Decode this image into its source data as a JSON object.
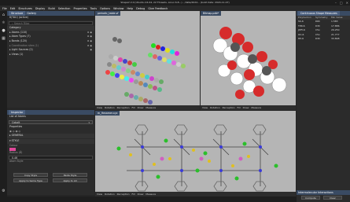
{
  "window": {
    "title": "ShapeV 2.0 (Ubuntu 24.04, 22 Threads, Linux 6.8...) - /data/2024... (build date: 2024-11-07)",
    "controls": [
      "–",
      "□",
      "✕"
    ]
  },
  "menu": [
    "File",
    "Edit",
    "Structures",
    "Display",
    "Build",
    "Selection",
    "Properties",
    "Tools",
    "Options",
    "Window",
    "Help",
    "Debug",
    "Give Feedback"
  ],
  "left_icons": [
    "house-icon",
    "molecule-icon",
    "atom-icon",
    "grid-icon",
    "wrench-icon"
  ],
  "structure_panel": {
    "tabs": [
      "Structure",
      "Gallery"
    ],
    "subtitle": "6(TAU) (active)",
    "search_placeholder": "Search Filter",
    "category_label": "Category",
    "items": [
      {
        "label": "▸ Atoms (110)"
      },
      {
        "label": "▸ Atom Types (7)"
      },
      {
        "label": "▸ Bonds (120)"
      },
      {
        "label": "▸ Coordination sites (1)"
      },
      {
        "label": "▸ Light Sources (2)"
      },
      {
        "label": "▸ Views (1)"
      }
    ]
  },
  "inspector": {
    "title": "Inspector",
    "subtitle": "List of Atoms",
    "element": "Cobalt",
    "section_properties": "Properties",
    "section_general": "GENERAL",
    "section_style": "STYLE",
    "style_labels": {
      "color": "Colour",
      "radius": "Radius (Å)",
      "radius_value": "0.46",
      "atom_style": "Atom Style"
    },
    "buttons": {
      "copy": "Copy Style",
      "paste": "Paste Style",
      "apply_type": "Apply to Same Type",
      "apply_all": "Apply to All"
    }
  },
  "viewports": {
    "v1_tab": "periodic_table.vf",
    "v2_tab": "Bitmap.pdb*",
    "v3_tab": "m_Hexamer.xyz",
    "toolbar": [
      "View",
      "Rotation",
      "Perception",
      "Fill",
      "Draw",
      "Measure"
    ]
  },
  "csm": {
    "title": "Continuous Shape Measures",
    "columns": [
      "Polyhedron",
      "Symmetry",
      "Min Value"
    ],
    "rows": [
      {
        "name": "SS-6",
        "sym": "D6h",
        "val": "1.583"
      },
      {
        "name": "TPR-6",
        "sym": "D3h",
        "val": "17.886"
      },
      {
        "name": "JPPY-6",
        "sym": "C5v",
        "val": "29.250"
      },
      {
        "name": "OC-6",
        "sym": "C5v",
        "val": "21.777"
      },
      {
        "name": "HP-6",
        "sym": "D3h",
        "val": "33.898"
      }
    ]
  },
  "intermolecular": {
    "title": "Intermolecular Interactions",
    "buttons": [
      "Compute",
      "Clear"
    ]
  }
}
